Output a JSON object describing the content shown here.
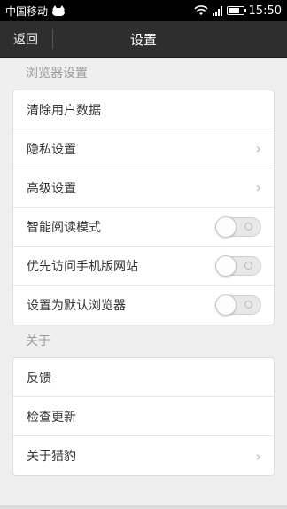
{
  "status_bar": {
    "carrier": "中国移动",
    "time": "15:50",
    "icons": [
      "cat-icon",
      "wifi-icon",
      "signal-icon",
      "battery-icon"
    ]
  },
  "header": {
    "back_label": "返回",
    "title": "设置"
  },
  "browser_section": {
    "label": "浏览器设置",
    "items": [
      {
        "label": "清除用户数据",
        "type": "plain"
      },
      {
        "label": "隐私设置",
        "type": "chevron"
      },
      {
        "label": "高级设置",
        "type": "chevron"
      },
      {
        "label": "智能阅读模式",
        "type": "toggle",
        "on": false
      },
      {
        "label": "优先访问手机版网站",
        "type": "toggle",
        "on": false
      },
      {
        "label": "设置为默认浏览器",
        "type": "toggle",
        "on": false
      }
    ]
  },
  "about_section": {
    "label": "关于",
    "items": [
      {
        "label": "反馈",
        "type": "plain"
      },
      {
        "label": "检查更新",
        "type": "plain"
      },
      {
        "label": "关于猎豹",
        "type": "chevron"
      }
    ]
  },
  "icons": {
    "chevron": "›"
  }
}
